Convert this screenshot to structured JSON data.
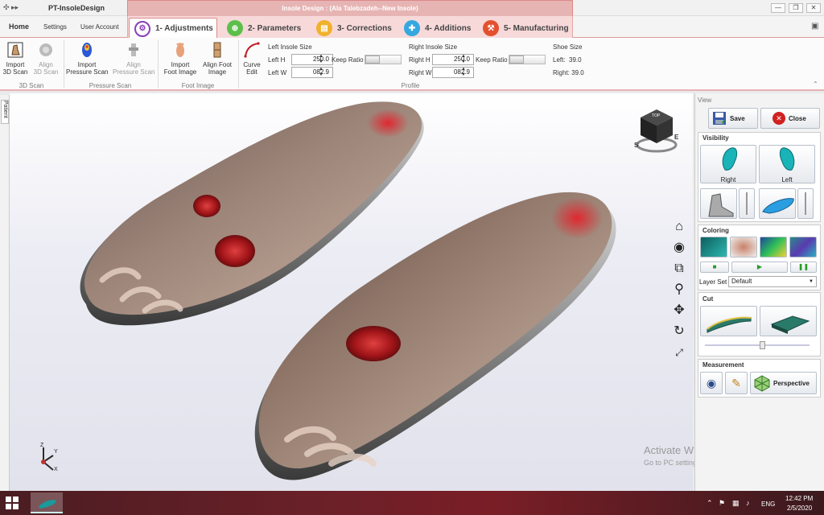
{
  "window": {
    "title": "Insole Design : (Ala Talebzadeh--New Insole)",
    "app_name": "PT-InsoleDesign",
    "quick_access": "✣ ▸▸",
    "controls": {
      "minimize": "—",
      "restore": "❐",
      "close": "✕"
    }
  },
  "menu": {
    "home": "Home",
    "settings": "Settings",
    "user_account": "User Account",
    "tabs": [
      {
        "label": "1- Adjustments",
        "color": "#8a3fb8",
        "icon": "gear-icon"
      },
      {
        "label": "2- Parameters",
        "color": "#5cbf4a",
        "icon": "sliders-icon"
      },
      {
        "label": "3- Corrections",
        "color": "#f0b12c",
        "icon": "clipboard-icon"
      },
      {
        "label": "4- Additions",
        "color": "#35a8e0",
        "icon": "plus-icon"
      },
      {
        "label": "5- Manufacturing",
        "color": "#e4502f",
        "icon": "factory-icon"
      }
    ]
  },
  "ribbon": {
    "scan3d": {
      "import": "Import\n3D Scan",
      "align": "Align\n3D Scan",
      "group": "3D Scan"
    },
    "pressure": {
      "import": "Import\nPressure Scan",
      "align": "Align\nPressure Scan",
      "group": "Pressure Scan"
    },
    "foot": {
      "import": "Import\nFoot Image",
      "align": "Align Foot\nImage",
      "group": "Foot Image"
    },
    "curve": "Curve\nEdit",
    "profile_group": "Profile",
    "left": {
      "title": "Left Insole Size",
      "h_label": "Left H",
      "h_value": "250.0",
      "w_label": "Left W",
      "w_value": "082.9",
      "keep_ratio": "Keep Ratio"
    },
    "right": {
      "title": "Right Insole Size",
      "h_label": "Right H",
      "h_value": "250.0",
      "w_label": "Right W",
      "w_value": "082.9",
      "keep_ratio": "Keep Ratio"
    },
    "shoe": {
      "title": "Shoe Size",
      "left": "Left:  39.0",
      "right": "Right: 39.0"
    }
  },
  "side_tab": "Patient",
  "viewcube": {
    "top": "TOP",
    "compass_s": "S",
    "compass_e": "E"
  },
  "axis": {
    "z": "Z",
    "y": "Y",
    "x": "X"
  },
  "panel": {
    "title": "View",
    "save": "Save",
    "close": "Close",
    "visibility": "Visibility",
    "vis_right": "Right",
    "vis_left": "Left",
    "coloring": "Coloring",
    "layer_set_label": "Layer Set",
    "layer_set_value": "Default",
    "cut": "Cut",
    "cut_slider": 0.55,
    "measurement": "Measurement",
    "perspective": "Perspective"
  },
  "watermark": {
    "line1": "Activate Windows",
    "line2": "Go to PC settings to activate Windows."
  },
  "taskbar": {
    "lang": "ENG",
    "time": "12:42 PM",
    "date": "2/5/2020"
  }
}
